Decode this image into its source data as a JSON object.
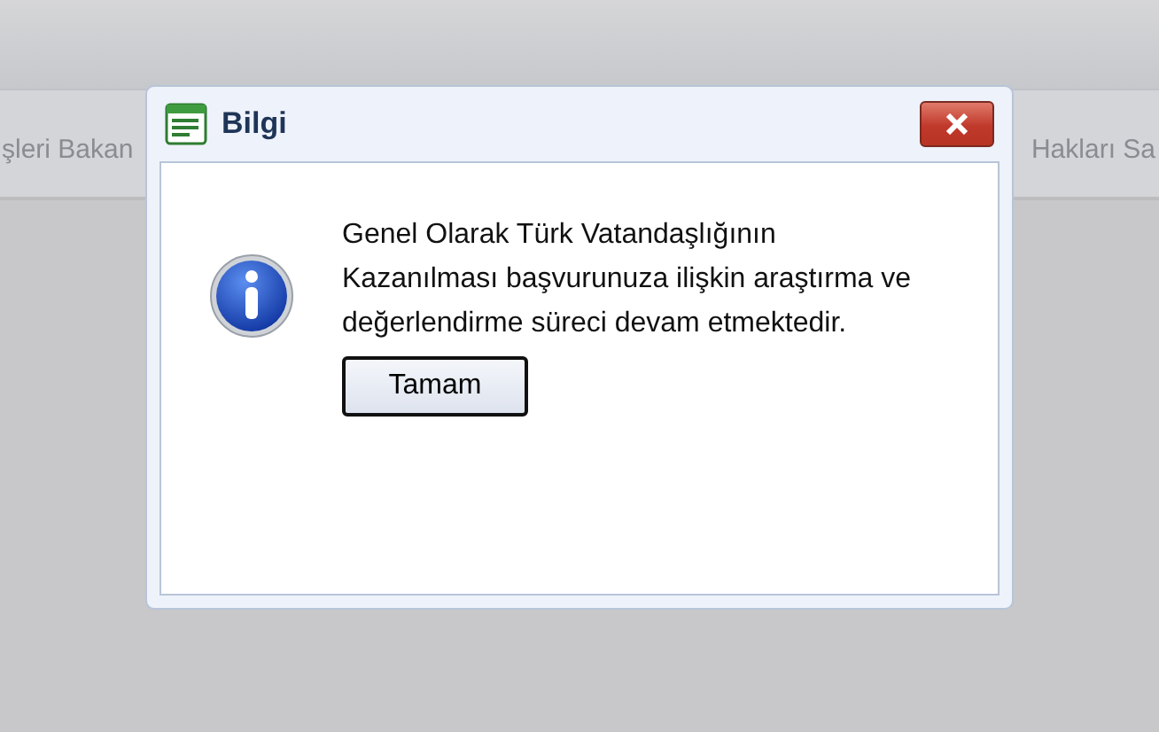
{
  "background_tabs": [
    "şleri Bakan",
    "Hakları Sa"
  ],
  "dialog": {
    "title": "Bilgi",
    "message": "Genel Olarak Türk Vatandaşlığının Kazanılması başvurunuza ilişkin araştırma ve değerlendirme süreci devam etmektedir.",
    "buttons": [
      "Tamam"
    ]
  }
}
